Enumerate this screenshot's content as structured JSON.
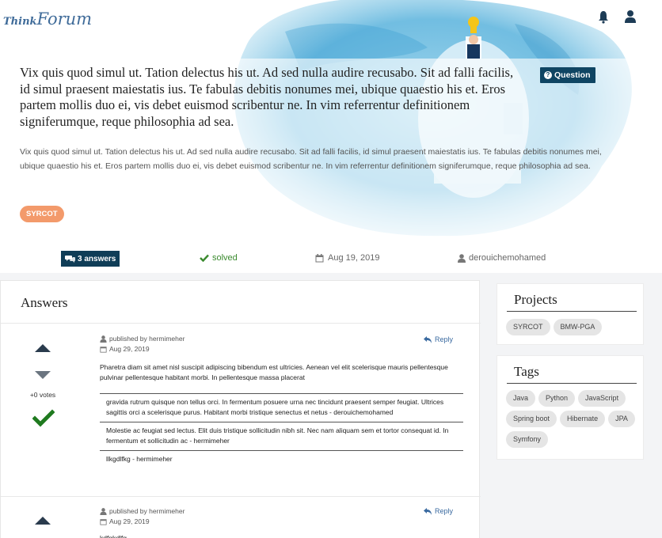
{
  "header": {
    "logo_think": "Think",
    "logo_forum": "Forum",
    "notifications_icon": "bell-icon",
    "user_icon": "user-icon"
  },
  "question": {
    "title": "Vix quis quod simul ut. Tation delectus his ut. Ad sed nulla audire recusabo. Sit ad falli facilis, id simul praesent maiestatis ius. Te fabulas debitis nonumes mei, ubique quaestio his et. Eros partem mollis duo ei, vis debet euismod scribentur ne. In vim referrentur definitionem signiferumque, reque philosophia ad sea.",
    "type_badge": "Question",
    "body": "Vix quis quod simul ut. Tation delectus his ut. Ad sed nulla audire recusabo. Sit ad falli facilis, id simul praesent maiestatis ius. Te fabulas debitis nonumes mei, ubique quaestio his et. Eros partem mollis duo ei, vis debet euismod scribentur ne. In vim referrentur definitionem signiferumque, reque philosophia ad sea.",
    "tag": "SYRCOT",
    "answers_count": "3 answers",
    "status": "solved",
    "date": "Aug 19, 2019",
    "author": "derouichemohamed"
  },
  "answers_section": {
    "heading": "Answers",
    "items": [
      {
        "published_by": "published by hermimeher",
        "date": "Aug 29, 2019",
        "reply_label": "Reply",
        "votes": "+0 votes",
        "accepted": true,
        "body": "Pharetra diam sit amet nisl suscipit adipiscing bibendum est ultricies. Aenean vel elit scelerisque mauris pellentesque pulvinar pellentesque habitant morbi. In pellentesque massa placerat",
        "comments": [
          "gravida rutrum quisque non tellus orci. In fermentum posuere urna nec tincidunt praesent semper feugiat. Ultrices sagittis orci a scelerisque purus. Habitant morbi tristique senectus et netus - derouichemohamed",
          "Molestie ac feugiat sed lectus. Elit duis tristique sollicitudin nibh sit. Nec nam aliquam sem et tortor consequat id. In fermentum et sollicitudin ac - hermimeher",
          "llkgdlfkg - hermimeher"
        ]
      },
      {
        "published_by": "published by hermimeher",
        "date": "Aug 29, 2019",
        "reply_label": "Reply",
        "body": "kdfgkdlfg"
      }
    ]
  },
  "sidebar": {
    "projects": {
      "title": "Projects",
      "items": [
        "SYRCOT",
        "BMW-PGA"
      ]
    },
    "tags": {
      "title": "Tags",
      "items": [
        "Java",
        "Python",
        "JavaScript",
        "Spring boot",
        "Hibernate",
        "JPA",
        "Symfony"
      ]
    }
  },
  "colors": {
    "accent_dark": "#0f4563",
    "tag_orange": "#f39a6b",
    "solved_green": "#3a8a2e",
    "hero_blue": "#7ec3e0"
  }
}
